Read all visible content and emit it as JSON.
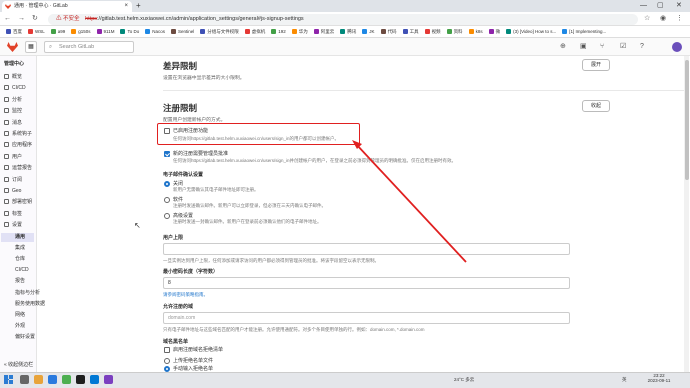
{
  "browser": {
    "tab_title": "通用 · 管理中心 · GitLab",
    "security_label": "不安全",
    "url_scheme": "https",
    "url_rest": "://gitlab.test.helm.xuxiaowei.cn/admin/application_settings/general#js-signup-settings",
    "bookmarks": [
      "百度",
      "WSL",
      "a99",
      "g150s",
      "911M",
      "To Do",
      "Nacos",
      "Sentinel",
      "分组与文件权限",
      "虚拟机",
      "192",
      "华为",
      "阿里云",
      "腾讯",
      "JK",
      "代码",
      "工具",
      "视频",
      "资料",
      "k8s",
      "微",
      "(3) [Video] How to s...",
      "[1] Implementing..."
    ]
  },
  "header": {
    "search_placeholder": "Search GitLab"
  },
  "sidebar": {
    "title": "管理中心",
    "items": [
      "概览",
      "CI/CD",
      "分析",
      "监控",
      "消息",
      "系统钩子",
      "应用程序",
      "用户",
      "运营报告",
      "订阅",
      "Geo",
      "部署密钥",
      "标签",
      "设置"
    ],
    "sub_items": [
      "通用",
      "集成",
      "仓库",
      "CI/CD",
      "报告",
      "指标与分析",
      "服务使用数据",
      "网络",
      "外观",
      "偏好设置"
    ],
    "collapse_label": "收起侧边栏"
  },
  "main": {
    "diff_section": {
      "title": "差异限制",
      "desc": "设置在浏览器中显示差异的大小限制。",
      "button": "展开"
    },
    "signup_section": {
      "title": "注册限制",
      "desc": "配置用户创建新帐户的方式。",
      "button": "收起",
      "signup_enabled_label": "已启用注册功能",
      "signup_enabled_hint": "任何访问https://gitlab.test.helm.xuxiaowei.cn/users/sign_in的用户都可以创建帐户。",
      "approval_label": "新的注册需要管理员批准",
      "approval_hint": "任何访问https://gitlab.test.helm.xuxiaowei.cn/users/sign_in并创建帐户的用户，在登录之前必须得到管理员的明确批准。仅在启用注册时有效。",
      "email_confirm_title": "电子邮件确认设置",
      "email_options": [
        {
          "label": "关闭",
          "hint": "新用户无需确认其电子邮件地址即可注册。"
        },
        {
          "label": "软件",
          "hint": "注册时发送确认邮件。新用户可以立即登录，但必须在三天内确认电子邮件。"
        },
        {
          "label": "高级设置",
          "hint": "注册时发送一封确认邮件。新用户在登录前必须确认他们的电子邮件地址。"
        }
      ],
      "user_cap_label": "用户上限",
      "user_cap_hint": "一旦实例达到用户上限，任何添加或请求访问的用户都必须得到管理员的批准。将该字段留空以表示无限制。",
      "min_password_label": "最小密码长度（字符数）",
      "min_password_value": "8",
      "min_password_hint_link": "请参阅密码策略指南。",
      "allowed_domains_label": "允许注册的域",
      "allowed_domains_placeholder": "domain.com",
      "allowed_domains_hint": "只有电子邮件地址与这些域名匹配的用户才能注册。允许使用通配符。对多个条目使用单独的行。例如：domain.com, *.domain.com",
      "denylist_label": "域名黑名单",
      "denylist_checkbox": "启用注册域名拒绝清单",
      "denylist_options": [
        "上传拒绝名单文件",
        "手动输入拒绝名单"
      ]
    }
  },
  "taskbar": {
    "weather": "24°C 多云",
    "time": "23:22",
    "date": "2023-09-11",
    "lang": "英"
  },
  "colors": {
    "accent": "#1f75cb",
    "annotation_red": "#e02020",
    "gitlab_orange": "#e24329"
  }
}
